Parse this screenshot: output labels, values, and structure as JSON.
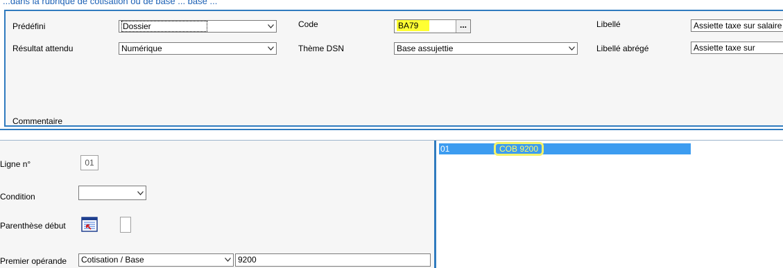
{
  "top_fragment": "...dans la rubrique de cotisation ou de base ... base ...",
  "header": {
    "predefini_label": "Prédéfini",
    "predefini_value": "Dossier",
    "code_label": "Code",
    "code_value": "BA79",
    "code_button": "...",
    "libelle_label": "Libellé",
    "libelle_value": "Assiette taxe sur salaire",
    "resultat_label": "Résultat attendu",
    "resultat_value": "Numérique",
    "theme_label": "Thème DSN",
    "theme_value": "Base assujettie",
    "libelle_abrege_label": "Libellé abrégé",
    "libelle_abrege_value": "Assiette taxe sur",
    "commentaire_label": "Commentaire"
  },
  "detail": {
    "ligne_label": "Ligne n°",
    "ligne_value": "01",
    "condition_label": "Condition",
    "condition_value": "",
    "parenthese_label": "Parenthèse début",
    "parenthese_value": "",
    "premier_label": "Premier opérande",
    "premier_type": "Cotisation / Base",
    "premier_value": "9200"
  },
  "lines_list": [
    {
      "num": "01",
      "text": "COB 9200"
    }
  ],
  "colors": {
    "accent": "#2f7bbf",
    "selection": "#3c9cf0",
    "highlight": "#ffff33"
  }
}
